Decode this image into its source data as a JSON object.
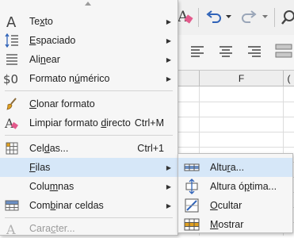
{
  "toolbar": {
    "undo_icon": "undo-icon",
    "redo_icon": "redo-icon",
    "search_icon": "find-icon"
  },
  "sheet": {
    "column_f": "F",
    "column_g_partial": "("
  },
  "menu": {
    "items": [
      {
        "icon": "text-A-icon",
        "pre": "Te",
        "u": "x",
        "post": "to",
        "submenu": true
      },
      {
        "icon": "line-spacing-icon",
        "pre": "",
        "u": "E",
        "post": "spaciado",
        "submenu": true
      },
      {
        "icon": "align-icon",
        "pre": "Ali",
        "u": "n",
        "post": "ear",
        "submenu": true
      },
      {
        "icon": "dollar-zero-icon",
        "pre": "Formato n",
        "u": "ú",
        "post": "mérico",
        "submenu": true
      },
      {
        "icon": "paintbrush-icon",
        "pre": "",
        "u": "C",
        "post": "lonar formato",
        "shortcut": ""
      },
      {
        "icon": "clear-format-icon",
        "pre": "Limpiar formato ",
        "u": "d",
        "post": "irecto",
        "shortcut": "Ctrl+M"
      },
      {
        "icon": "cells-icon",
        "pre": "Cel",
        "u": "d",
        "post": "as...",
        "shortcut": "Ctrl+1"
      },
      {
        "icon": "",
        "pre": "",
        "u": "F",
        "post": "ilas",
        "submenu": true
      },
      {
        "icon": "",
        "pre": "Colu",
        "u": "m",
        "post": "nas",
        "submenu": true
      },
      {
        "icon": "merge-cells-icon",
        "pre": "Com",
        "u": "b",
        "post": "inar celdas",
        "submenu": true
      },
      {
        "icon": "character-icon",
        "pre": "Cara",
        "u": "c",
        "post": "ter...",
        "disabled": true
      }
    ]
  },
  "submenu": {
    "items": [
      {
        "icon": "row-height-icon",
        "pre": "Altu",
        "u": "r",
        "post": "a..."
      },
      {
        "icon": "optimal-height-icon",
        "pre": "Altura ó",
        "u": "p",
        "post": "tima..."
      },
      {
        "icon": "hide-icon",
        "pre": "",
        "u": "O",
        "post": "cultar"
      },
      {
        "icon": "show-icon",
        "pre": "",
        "u": "M",
        "post": "ostrar"
      }
    ]
  }
}
